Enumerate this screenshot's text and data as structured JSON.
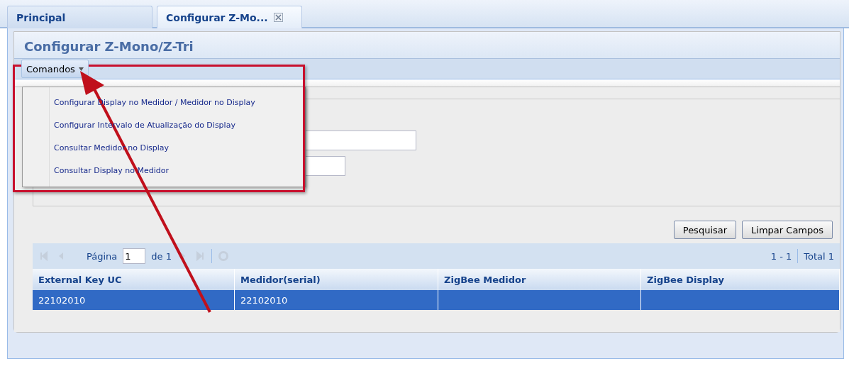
{
  "tabs": [
    {
      "label": "Principal",
      "selected": false,
      "closable": false
    },
    {
      "label": "Configurar Z-Mo...",
      "selected": true,
      "closable": true
    }
  ],
  "panel": {
    "title": "Configurar Z-Mono/Z-Tri"
  },
  "toolbar": {
    "button": "Comandos",
    "expanded": true
  },
  "menu": {
    "items": [
      "Configurar Display no Medidor / Medidor no Display",
      "Configurar Intervalo de Atualização do Display",
      "Consultar Medidor no Display",
      "Consultar Display no Medidor"
    ]
  },
  "form": {
    "fields": [
      {
        "kind": "wide"
      },
      {
        "kind": "narrow"
      }
    ]
  },
  "buttons": [
    "Pesquisar",
    "Limpar Campos"
  ],
  "pager": {
    "page_label": "Página",
    "page": "1",
    "of_label": "de 1",
    "range": "1 - 1",
    "total": "Total 1"
  },
  "table": {
    "columns": [
      "External Key UC",
      "Medidor(serial)",
      "ZigBee Medidor",
      "ZigBee Display"
    ],
    "rows": [
      {
        "cells": [
          "22102010",
          "22102010",
          "",
          ""
        ],
        "selected": true
      }
    ]
  }
}
